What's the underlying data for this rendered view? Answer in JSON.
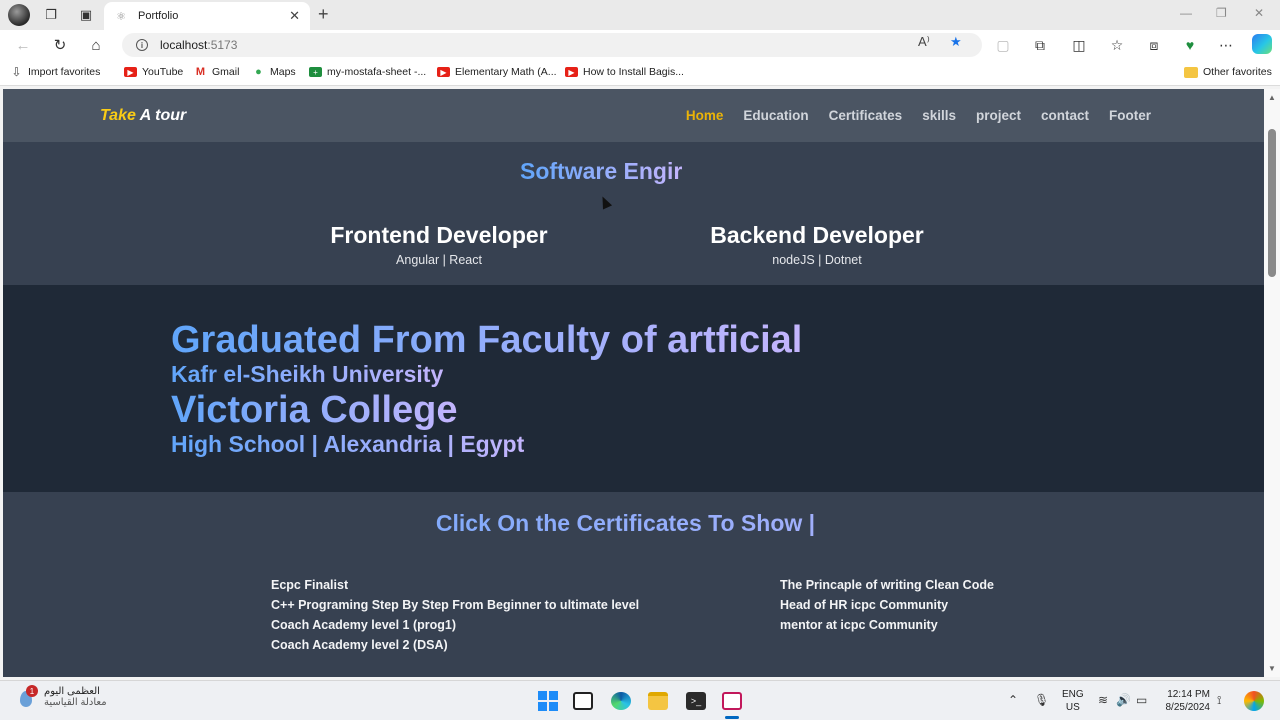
{
  "browser": {
    "tab_title": "Portfolio",
    "url_host": "localhost",
    "url_port": ":5173",
    "bookmarks": [
      {
        "label": "Import favorites",
        "icon": "import-icon"
      },
      {
        "label": "YouTube",
        "icon": "youtube-icon"
      },
      {
        "label": "Gmail",
        "icon": "gmail-icon"
      },
      {
        "label": "Maps",
        "icon": "maps-icon"
      },
      {
        "label": "my-mostafa-sheet -...",
        "icon": "sheets-icon"
      },
      {
        "label": "Elementary Math (A...",
        "icon": "youtube-icon"
      },
      {
        "label": "How to Install Bagis...",
        "icon": "youtube-icon"
      }
    ],
    "other_favorites": "Other favorites"
  },
  "site": {
    "brand_highlight": "Take",
    "brand_rest": " A tour",
    "nav": [
      "Home",
      "Education",
      "Certificates",
      "skills",
      "project",
      "contact",
      "Footer"
    ],
    "active_nav": "Home",
    "typing_text": "Software Engir",
    "roles": [
      {
        "title": "Frontend Developer",
        "stack": "Angular | React"
      },
      {
        "title": "Backend Developer",
        "stack": "nodeJS | Dotnet"
      }
    ],
    "education": {
      "line1": "Graduated From Faculty of artficial",
      "line2": "Kafr el-Sheikh University",
      "line3": "Victoria College",
      "line4": "High School | Alexandria | Egypt"
    },
    "certificates": {
      "title": "Click On the Certificates To Show |",
      "left": [
        "Ecpc Finalist",
        "C++ Programing Step By Step From Beginner to ultimate level",
        "Coach Academy level 1 (prog1)",
        "Coach Academy level 2 (DSA)"
      ],
      "right": [
        "The Princaple of writing Clean Code",
        "Head of HR icpc Community",
        "mentor at icpc Community"
      ]
    }
  },
  "taskbar": {
    "weather_line1": "العظمى اليوم",
    "weather_line2": "معادلة القياسية",
    "weather_badge": "1",
    "lang_line1": "ENG",
    "lang_line2": "US",
    "time": "12:14 PM",
    "date": "8/25/2024"
  }
}
